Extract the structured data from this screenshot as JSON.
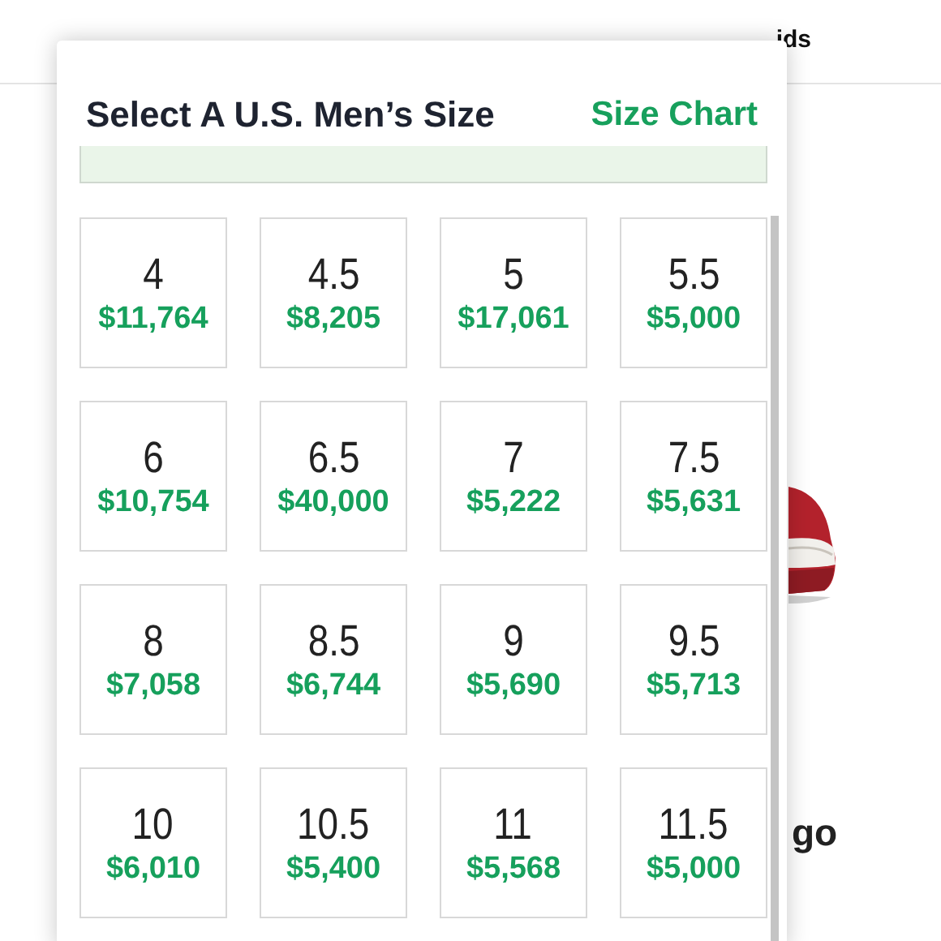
{
  "background": {
    "nav_link": "ids",
    "heading_fragment": "go"
  },
  "size_dialog": {
    "title": "Select A U.S. Men’s Size",
    "size_chart_link": "Size Chart",
    "sizes": [
      {
        "size": "4",
        "price": "$11,764"
      },
      {
        "size": "4.5",
        "price": "$8,205"
      },
      {
        "size": "5",
        "price": "$17,061"
      },
      {
        "size": "5.5",
        "price": "$5,000"
      },
      {
        "size": "6",
        "price": "$10,754"
      },
      {
        "size": "6.5",
        "price": "$40,000"
      },
      {
        "size": "7",
        "price": "$5,222"
      },
      {
        "size": "7.5",
        "price": "$5,631"
      },
      {
        "size": "8",
        "price": "$7,058"
      },
      {
        "size": "8.5",
        "price": "$6,744"
      },
      {
        "size": "9",
        "price": "$5,690"
      },
      {
        "size": "9.5",
        "price": "$5,713"
      },
      {
        "size": "10",
        "price": "$6,010"
      },
      {
        "size": "10.5",
        "price": "$5,400"
      },
      {
        "size": "11",
        "price": "$5,568"
      },
      {
        "size": "11.5",
        "price": "$5,000"
      }
    ]
  }
}
